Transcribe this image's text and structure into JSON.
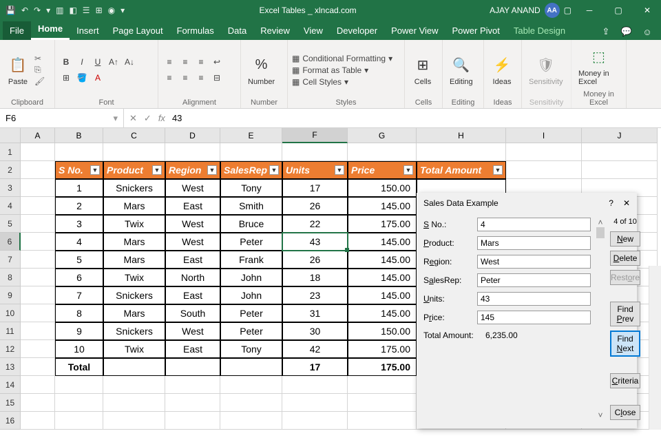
{
  "title": "Excel Tables _ xlncad.com",
  "user": {
    "name": "AJAY ANAND",
    "initials": "AA"
  },
  "tabs": [
    "File",
    "Home",
    "Insert",
    "Page Layout",
    "Formulas",
    "Data",
    "Review",
    "View",
    "Developer",
    "Power View",
    "Power Pivot",
    "Table Design"
  ],
  "ribbon": {
    "clipboard": "Clipboard",
    "paste": "Paste",
    "font": "Font",
    "alignment": "Alignment",
    "number": "Number",
    "numberLabel": "Number",
    "styles": "Styles",
    "condFmt": "Conditional Formatting",
    "fmtTable": "Format as Table",
    "cellStyles": "Cell Styles",
    "cells": "Cells",
    "editing": "Editing",
    "ideas": "Ideas",
    "sensitivity": "Sensitivity",
    "money": "Money in Excel"
  },
  "nameBox": "F6",
  "formula": "43",
  "cols": [
    "A",
    "B",
    "C",
    "D",
    "E",
    "F",
    "G",
    "H",
    "I",
    "J"
  ],
  "rows": [
    "1",
    "2",
    "3",
    "4",
    "5",
    "6",
    "7",
    "8",
    "9",
    "10",
    "11",
    "12",
    "13",
    "14",
    "15",
    "16"
  ],
  "headers": [
    "S No.",
    "Product",
    "Region",
    "SalesRep",
    "Units",
    "Price",
    "Total Amount"
  ],
  "data": [
    {
      "n": "1",
      "p": "Snickers",
      "r": "West",
      "s": "Tony",
      "u": "17",
      "pr": "150.00"
    },
    {
      "n": "2",
      "p": "Mars",
      "r": "East",
      "s": "Smith",
      "u": "26",
      "pr": "145.00"
    },
    {
      "n": "3",
      "p": "Twix",
      "r": "West",
      "s": "Bruce",
      "u": "22",
      "pr": "175.00"
    },
    {
      "n": "4",
      "p": "Mars",
      "r": "West",
      "s": "Peter",
      "u": "43",
      "pr": "145.00"
    },
    {
      "n": "5",
      "p": "Mars",
      "r": "East",
      "s": "Frank",
      "u": "26",
      "pr": "145.00"
    },
    {
      "n": "6",
      "p": "Twix",
      "r": "North",
      "s": "John",
      "u": "18",
      "pr": "145.00"
    },
    {
      "n": "7",
      "p": "Snickers",
      "r": "East",
      "s": "John",
      "u": "23",
      "pr": "145.00"
    },
    {
      "n": "8",
      "p": "Mars",
      "r": "South",
      "s": "Peter",
      "u": "31",
      "pr": "145.00"
    },
    {
      "n": "9",
      "p": "Snickers",
      "r": "West",
      "s": "Peter",
      "u": "30",
      "pr": "150.00"
    },
    {
      "n": "10",
      "p": "Twix",
      "r": "East",
      "s": "Tony",
      "u": "42",
      "pr": "175.00"
    }
  ],
  "totals": {
    "label": "Total",
    "u": "17",
    "pr": "175.00"
  },
  "dialog": {
    "title": "Sales Data Example",
    "count": "4 of 10",
    "fields": {
      "sno": {
        "label": "S No.:",
        "val": "4"
      },
      "product": {
        "label": "Product:",
        "val": "Mars"
      },
      "region": {
        "label": "Region:",
        "val": "West"
      },
      "salesrep": {
        "label": "SalesRep:",
        "val": "Peter"
      },
      "units": {
        "label": "Units:",
        "val": "43"
      },
      "price": {
        "label": "Price:",
        "val": "145"
      },
      "total": {
        "label": "Total Amount:",
        "val": "6,235.00"
      }
    },
    "btns": {
      "new": "New",
      "delete": "Delete",
      "restore": "Restore",
      "findPrev": "Find Prev",
      "findNext": "Find Next",
      "criteria": "Criteria",
      "close": "Close"
    }
  }
}
